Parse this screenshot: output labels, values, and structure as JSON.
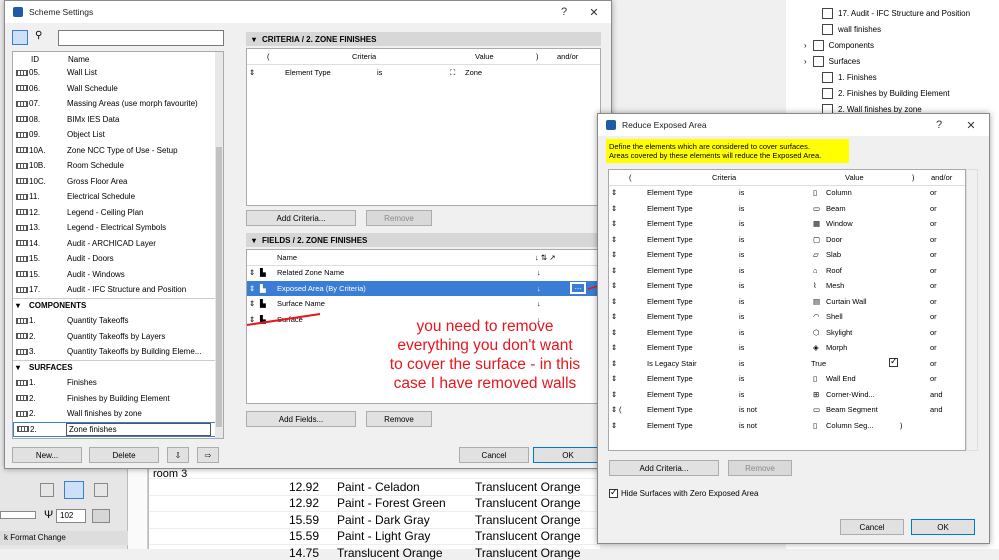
{
  "background": {
    "tree": [
      {
        "label": "17. Audit - IFC Structure and Position",
        "indent": 1
      },
      {
        "label": "wall finishes",
        "indent": 1
      },
      {
        "label": "Components",
        "indent": 0
      },
      {
        "label": "Surfaces",
        "indent": 0
      },
      {
        "label": "1. Finishes",
        "indent": 1
      },
      {
        "label": "2. Finishes by Building Element",
        "indent": 1
      },
      {
        "label": "2. Wall finishes by zone",
        "indent": 1
      }
    ],
    "schedule_label": "room 3",
    "schedule_rows": [
      {
        "value": "12.92",
        "material": "Paint - Celadon",
        "finish": "Translucent Orange"
      },
      {
        "value": "12.92",
        "material": "Paint - Forest Green",
        "finish": "Translucent Orange"
      },
      {
        "value": "15.59",
        "material": "Paint - Dark Gray",
        "finish": "Translucent Orange"
      },
      {
        "value": "15.59",
        "material": "Paint - Light Gray",
        "finish": "Translucent Orange"
      },
      {
        "value": "14.75",
        "material": "Translucent Orange",
        "finish": "Translucent Orange"
      }
    ],
    "zoom_value": "102",
    "format_change": "Format Change"
  },
  "scheme": {
    "title": "Scheme Settings",
    "help": "?",
    "close": "✕",
    "search_value": "",
    "col_id": "ID",
    "col_name": "Name",
    "items": [
      {
        "id": "05.",
        "name": "Wall List"
      },
      {
        "id": "06.",
        "name": "Wall Schedule"
      },
      {
        "id": "07.",
        "name": "Massing Areas (use morph favourite)"
      },
      {
        "id": "08.",
        "name": "BIMx IES Data"
      },
      {
        "id": "09.",
        "name": "Object List"
      },
      {
        "id": "10A.",
        "name": "Zone NCC Type of Use - Setup"
      },
      {
        "id": "10B.",
        "name": "Room Schedule"
      },
      {
        "id": "10C.",
        "name": "Gross Floor Area"
      },
      {
        "id": "11.",
        "name": "Electrical Schedule"
      },
      {
        "id": "12.",
        "name": "Legend - Ceiling Plan"
      },
      {
        "id": "13.",
        "name": "Legend - Electrical Symbols"
      },
      {
        "id": "14.",
        "name": "Audit - ARCHICAD Layer"
      },
      {
        "id": "15.",
        "name": "Audit - Doors"
      },
      {
        "id": "15.",
        "name": "Audit - Windows"
      },
      {
        "id": "17.",
        "name": "Audit - IFC Structure and Position"
      }
    ],
    "components_header": "COMPONENTS",
    "components": [
      {
        "id": "1.",
        "name": "Quantity Takeoffs"
      },
      {
        "id": "2.",
        "name": "Quantity Takeoffs by Layers"
      },
      {
        "id": "3.",
        "name": "Quantity Takeoffs by Building Eleme..."
      }
    ],
    "surfaces_header": "SURFACES",
    "surfaces": [
      {
        "id": "1.",
        "name": "Finishes"
      },
      {
        "id": "2.",
        "name": "Finishes by Building Element"
      },
      {
        "id": "2.",
        "name": "Wall finishes by zone"
      }
    ],
    "editing": {
      "id": "2.",
      "name": "Zone finishes"
    },
    "new_btn": "New...",
    "delete_btn": "Delete",
    "criteria_title": "CRITERIA / 2. ZONE FINISHES",
    "criteria_cols": {
      "paren": "(",
      "criteria": "Criteria",
      "value": "Value",
      "close": ")",
      "andor": "and/or"
    },
    "criteria_row": {
      "criteria": "Element Type",
      "op": "is",
      "value": "Zone"
    },
    "add_criteria": "Add Criteria...",
    "remove": "Remove",
    "fields_title": "FIELDS / 2. ZONE FINISHES",
    "fields_col": "Name",
    "fields": [
      {
        "name": "Related Zone Name",
        "selected": false
      },
      {
        "name": "Exposed Area (By Criteria)",
        "selected": true
      },
      {
        "name": "Surface Name",
        "selected": false
      },
      {
        "name": "Surface",
        "selected": false
      }
    ],
    "add_fields": "Add Fields...",
    "remove_fields": "Remove",
    "cancel": "Cancel",
    "ok": "OK"
  },
  "annotation": {
    "lines": [
      "you need to remove",
      "everything you don't want",
      "to cover the surface - in this",
      "case I have removed walls"
    ],
    "color": "#e8161d"
  },
  "reduce": {
    "title": "Reduce Exposed Area",
    "help": "?",
    "close": "✕",
    "info_line1": "Define the elements which are considered to cover surfaces.",
    "info_line2": "Areas covered by these elements will reduce the Exposed Area.",
    "info_bg": "#ffff00",
    "cols": {
      "paren": "(",
      "criteria": "Criteria",
      "value": "Value",
      "close": ")",
      "andor": "and/or"
    },
    "rows": [
      {
        "paren": "",
        "criteria": "Element Type",
        "op": "is",
        "value": "Column",
        "close": "",
        "andor": "or"
      },
      {
        "paren": "",
        "criteria": "Element Type",
        "op": "is",
        "value": "Beam",
        "close": "",
        "andor": "or"
      },
      {
        "paren": "",
        "criteria": "Element Type",
        "op": "is",
        "value": "Window",
        "close": "",
        "andor": "or"
      },
      {
        "paren": "",
        "criteria": "Element Type",
        "op": "is",
        "value": "Door",
        "close": "",
        "andor": "or"
      },
      {
        "paren": "",
        "criteria": "Element Type",
        "op": "is",
        "value": "Slab",
        "close": "",
        "andor": "or"
      },
      {
        "paren": "",
        "criteria": "Element Type",
        "op": "is",
        "value": "Roof",
        "close": "",
        "andor": "or"
      },
      {
        "paren": "",
        "criteria": "Element Type",
        "op": "is",
        "value": "Mesh",
        "close": "",
        "andor": "or"
      },
      {
        "paren": "",
        "criteria": "Element Type",
        "op": "is",
        "value": "Curtain Wall",
        "close": "",
        "andor": "or"
      },
      {
        "paren": "",
        "criteria": "Element Type",
        "op": "is",
        "value": "Shell",
        "close": "",
        "andor": "or"
      },
      {
        "paren": "",
        "criteria": "Element Type",
        "op": "is",
        "value": "Skylight",
        "close": "",
        "andor": "or"
      },
      {
        "paren": "",
        "criteria": "Element Type",
        "op": "is",
        "value": "Morph",
        "close": "",
        "andor": "or"
      },
      {
        "paren": "",
        "criteria": "Is Legacy Stair",
        "op": "is",
        "value": "True",
        "close": "",
        "andor": "or"
      },
      {
        "paren": "",
        "criteria": "Element Type",
        "op": "is",
        "value": "Wall End",
        "close": "",
        "andor": "or"
      },
      {
        "paren": "",
        "criteria": "Element Type",
        "op": "is",
        "value": "Corner-Wind...",
        "close": "",
        "andor": "and"
      },
      {
        "paren": "(",
        "criteria": "Element Type",
        "op": "is not",
        "value": "Beam Segment",
        "close": "",
        "andor": "and"
      },
      {
        "paren": "",
        "criteria": "Element Type",
        "op": "is not",
        "value": "Column Seg...",
        "close": ")",
        "andor": ""
      }
    ],
    "add_criteria": "Add Criteria...",
    "remove": "Remove",
    "hide_zero": "Hide Surfaces with Zero Exposed Area",
    "hide_zero_checked": true,
    "cancel": "Cancel",
    "ok": "OK"
  }
}
